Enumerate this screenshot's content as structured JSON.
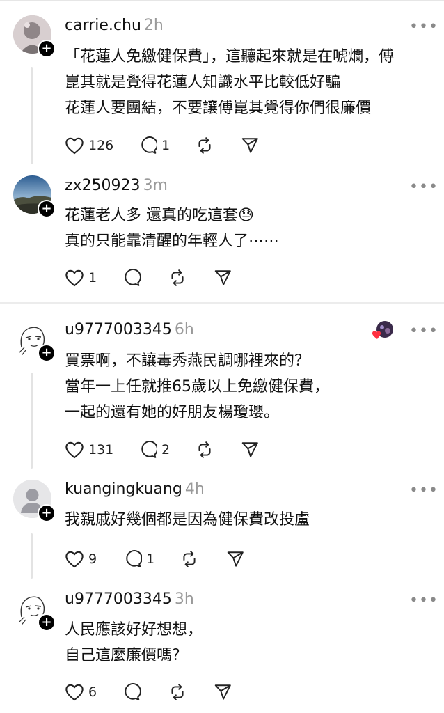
{
  "posts": [
    {
      "username": "carrie.chu",
      "time": "2h",
      "lines": [
        "「花蓮人免繳健保費」，這聽起來就是在唬爛，傅",
        "崑其就是覺得花蓮人知識水平比較低好騙",
        "花蓮人要團結，不要讓傅崑其覺得你們很廉價"
      ],
      "likes": "126",
      "replies": "1"
    },
    {
      "username": "zx250923",
      "time": "3m",
      "lines": [
        "花蓮老人多 還真的吃這套😓",
        "真的只能靠清醒的年輕人了⋯⋯"
      ],
      "likes": "1",
      "replies": ""
    },
    {
      "username": "u9777003345",
      "time": "6h",
      "lines": [
        "買票啊，不讓毒秀燕民調哪裡來的？",
        "當年一上任就推65歲以上免繳健保費，",
        "一起的還有她的好朋友楊瓊瓔。"
      ],
      "likes": "131",
      "replies": "2"
    },
    {
      "username": "kuangingkuang",
      "time": "4h",
      "lines": [
        "我親戚好幾個都是因為健保費改投盧"
      ],
      "likes": "9",
      "replies": "1"
    },
    {
      "username": "u9777003345",
      "time": "3h",
      "lines": [
        "人民應該好好想想，",
        "自己這麼廉價嗎？"
      ],
      "likes": "6",
      "replies": ""
    }
  ],
  "more_label": "•••",
  "plus_label": "+",
  "icons": {
    "like": "heart-icon",
    "reply": "comment-icon",
    "repost": "repost-icon",
    "share": "send-icon",
    "more": "more-icon",
    "follow": "plus-icon"
  },
  "colors": {
    "text": "#111111",
    "muted": "#9a9a9a",
    "thread_line": "#e3e3e3",
    "reaction_heart": "#ff3040"
  }
}
